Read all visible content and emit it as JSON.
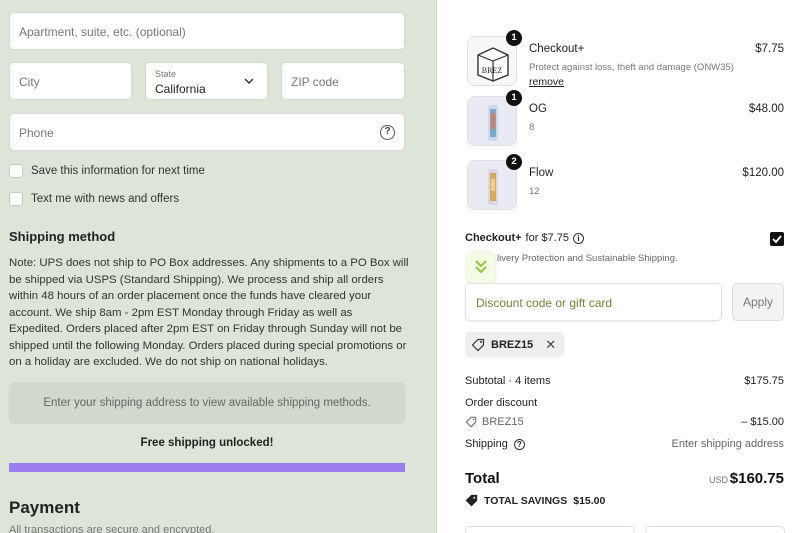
{
  "address": {
    "apartment_placeholder": "Apartment, suite, etc. (optional)",
    "city_placeholder": "City",
    "state_label": "State",
    "state_value": "California",
    "zip_placeholder": "ZIP code",
    "phone_placeholder": "Phone",
    "help_glyph": "?"
  },
  "options": {
    "save_info_label": "Save this information for next time",
    "news_label": "Text me with news and offers"
  },
  "shipping": {
    "title": "Shipping method",
    "note": "Note: UPS does not ship to PO Box addresses. Any shipments to a PO Box will be shipped via USPS (Standard Shipping). We process and ship all orders within 48 hours of an order placement once the funds have cleared your account. We ship 8am - 2pm EST Monday through Friday as well as Expedited. Orders placed after 2pm EST on Friday through Sunday will not be shipped until the following Monday. Orders placed during special promotions or on a holiday are excluded. We do not ship on national holidays.",
    "placeholder_box": "Enter your shipping address to view available shipping methods.",
    "free_shipping": "Free shipping unlocked!",
    "progress_fraction": 1.0,
    "progress_color": "#9b7df0"
  },
  "payment": {
    "title": "Payment",
    "subtitle": "All transactions are secure and encrypted."
  },
  "cart": {
    "items": [
      {
        "name": "Checkout+",
        "sub": "Protect against loss, theft and damage (ONW35)",
        "price": "$7.75",
        "qty": "1",
        "remove": "remove",
        "thumb_text": "BREZ",
        "icon": "box-icon"
      },
      {
        "name": "OG",
        "sub": "8",
        "price": "$48.00",
        "qty": "1",
        "icon": "can-icon"
      },
      {
        "name": "Flow",
        "sub": "12",
        "price": "$120.00",
        "qty": "2",
        "icon": "can-icon"
      }
    ]
  },
  "checkout_plus": {
    "brand": "Checkout+",
    "price_text": "for $7.75",
    "info_glyph": "i",
    "description": "livery Protection and Sustainable Shipping.",
    "checked": true
  },
  "discount": {
    "placeholder": "Discount code or gift card",
    "apply_label": "Apply",
    "code": "BREZ15",
    "remove_glyph": "✕"
  },
  "summary": {
    "subtotal_label": "Subtotal · 4 items",
    "subtotal_value": "$175.75",
    "order_discount_label": "Order discount",
    "discount_code": "BREZ15",
    "discount_value": "– $15.00",
    "shipping_label": "Shipping",
    "shipping_value": "Enter shipping address",
    "total_label": "Total",
    "currency": "USD",
    "total_value": "$160.75",
    "savings_label": "TOTAL SAVINGS",
    "savings_value": "$15.00"
  },
  "colors": {
    "left_bg": "#dde5d8",
    "accent_green": "#6a8a34",
    "progress": "#9b7df0"
  }
}
